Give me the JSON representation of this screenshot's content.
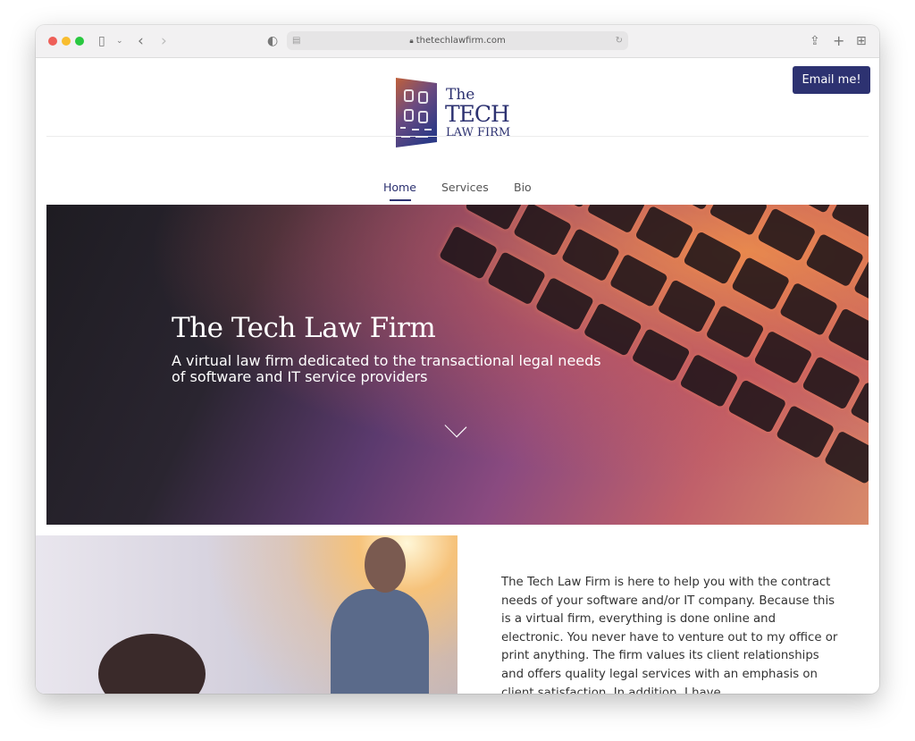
{
  "browser": {
    "url": "thetechlawfirm.com",
    "icons": [
      "sidebar-icon",
      "chevron-down-icon",
      "back-icon",
      "forward-icon",
      "shield-icon",
      "reader-icon",
      "lock-icon",
      "reload-icon",
      "share-icon",
      "new-tab-icon",
      "tab-overview-icon"
    ]
  },
  "logo": {
    "line1": "The",
    "line2": "TECH",
    "line3": "LAW FIRM"
  },
  "header": {
    "email_button": "Email me!"
  },
  "nav": {
    "items": [
      {
        "label": "Home",
        "active": true
      },
      {
        "label": "Services"
      },
      {
        "label": "Bio"
      }
    ]
  },
  "hero": {
    "title": "The Tech Law Firm",
    "subtitle": "A virtual law firm dedicated to the transactional legal needs of software and IT service providers"
  },
  "about": {
    "text": "The Tech Law Firm is here to help you with the contract needs of your software and/or IT company. Because this is a virtual firm, everything is done online and electronic. You never have to venture out to my office or print anything. The firm values its client relationships and offers quality legal services with an emphasis on client satisfaction. In addition, I have"
  },
  "colors": {
    "brand": "#2d3271",
    "accent_orange": "#c0603a"
  }
}
